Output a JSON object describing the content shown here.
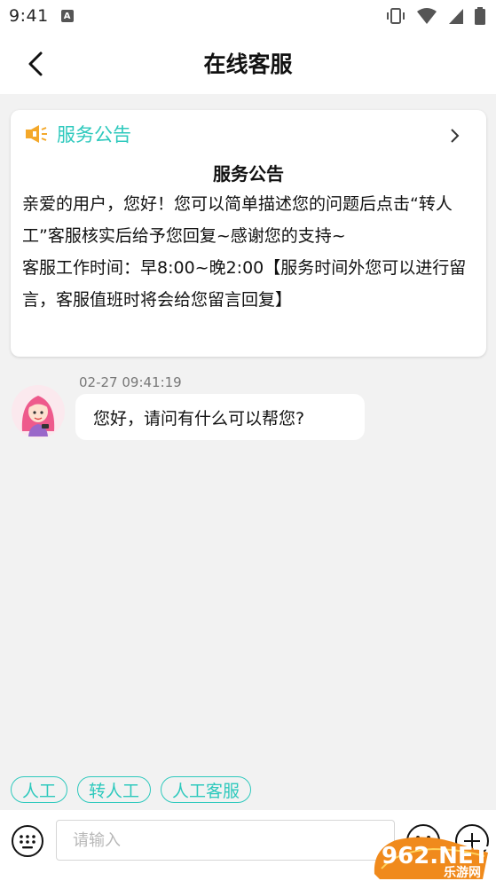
{
  "status_bar": {
    "time": "9:41",
    "notification_icon": "A",
    "icons": [
      "vibrate-icon",
      "wifi-icon",
      "cell-signal-icon",
      "battery-icon"
    ]
  },
  "header": {
    "title": "在线客服",
    "back_icon": "chevron-left-icon"
  },
  "notice": {
    "label": "服务公告",
    "title": "服务公告",
    "paragraphs": [
      "亲爱的用户，您好！您可以简单描述您的问题后点击“转人工”客服核实后给予您回复~感谢您的支持~",
      "客服工作时间：早8:00~晚2:00【服务时间外您可以进行留言，客服值班时将会给您留言回复】"
    ],
    "accent_color": "#2ec9bd",
    "icon_color": "#f4a82a"
  },
  "messages": [
    {
      "time": "02-27 09:41:19",
      "text": "您好，请问有什么可以帮您?"
    }
  ],
  "quick_replies": [
    "人工",
    "转人工",
    "人工客服"
  ],
  "input": {
    "placeholder": "请输入",
    "value": ""
  },
  "watermark": {
    "text_top": "962.NET",
    "text_bottom": "乐游网"
  }
}
